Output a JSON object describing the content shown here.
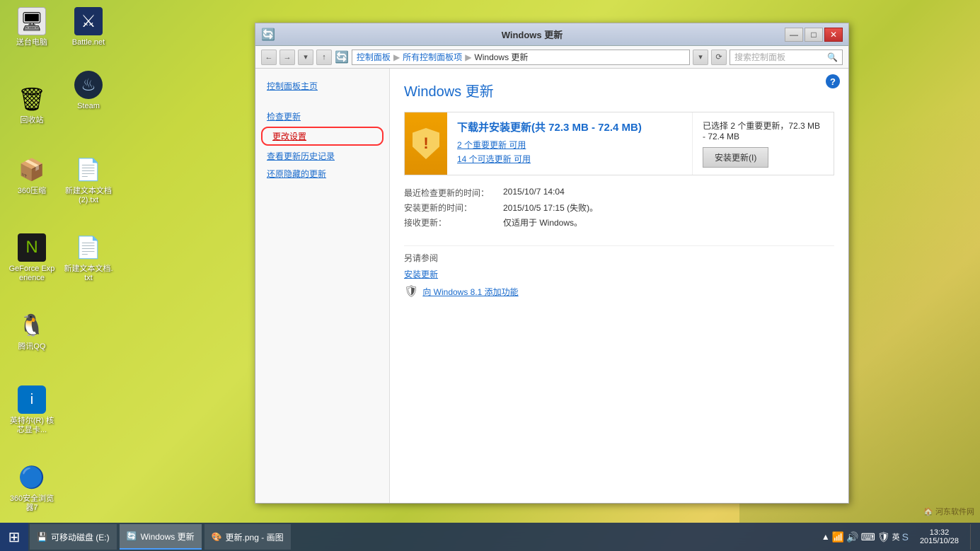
{
  "desktop": {
    "icons": [
      {
        "id": "my-computer",
        "label": "送台电脑",
        "symbol": "🖥"
      },
      {
        "id": "battle-net",
        "label": "Battle.net",
        "symbol": "🎮"
      },
      {
        "id": "recycle-bin",
        "label": "回收站",
        "symbol": "🗑"
      },
      {
        "id": "steam",
        "label": "Steam",
        "symbol": "💨"
      },
      {
        "id": "360zip",
        "label": "360压缩",
        "symbol": "📦"
      },
      {
        "id": "new-txt1",
        "label": "新建文本文档 (2).txt",
        "symbol": "📄"
      },
      {
        "id": "geforce",
        "label": "GeForce Experience",
        "symbol": "🎯"
      },
      {
        "id": "new-txt2",
        "label": "新建文本文档.txt",
        "symbol": "📄"
      },
      {
        "id": "qq",
        "label": "腾讯QQ",
        "symbol": "🐧"
      },
      {
        "id": "intel",
        "label": "英特尔(R) 核芯显卡...",
        "symbol": "💻"
      },
      {
        "id": "360browser",
        "label": "360安全浏览器7",
        "symbol": "🔵"
      }
    ]
  },
  "window": {
    "title": "Windows 更新",
    "title_bar_icon": "🔄",
    "controls": {
      "minimize": "—",
      "maximize": "□",
      "close": "✕"
    }
  },
  "address_bar": {
    "back_btn": "←",
    "forward_btn": "→",
    "up_btn": "↑",
    "refresh_btn": "⟳",
    "path": {
      "root": "控制面板",
      "sep1": "▶",
      "mid": "所有控制面板项",
      "sep2": "▶",
      "current": "Windows 更新"
    },
    "search_placeholder": "搜索控制面板",
    "dropdown_icon": "▾"
  },
  "sidebar": {
    "main_link": "控制面板主页",
    "links": [
      {
        "id": "check-update",
        "label": "检查更新",
        "highlighted": false
      },
      {
        "id": "change-settings",
        "label": "更改设置",
        "highlighted": true
      },
      {
        "id": "view-history",
        "label": "查看更新历史记录",
        "highlighted": false
      },
      {
        "id": "restore-hidden",
        "label": "还原隐藏的更新",
        "highlighted": false
      }
    ]
  },
  "main": {
    "page_title": "Windows 更新",
    "update": {
      "title": "下载并安装更新(共 72.3 MB - 72.4 MB)",
      "important_link": "2 个重要更新 可用",
      "optional_link": "14 个可选更新 可用",
      "side_text": "已选择 2 个重要更新，72.3 MB - 72.4 MB",
      "install_btn": "安装更新(I)"
    },
    "info": {
      "last_check_label": "最近检查更新的时间：",
      "last_check_value": "2015/10/7 14:04",
      "last_install_label": "安装更新的时间：",
      "last_install_value": "2015/10/5 17:15 (失败)。",
      "receive_label": "接收更新：",
      "receive_value": "仅适用于 Windows。"
    },
    "also_see": {
      "title": "另请参阅",
      "links": [
        {
          "id": "install-update",
          "label": "安装更新"
        },
        {
          "id": "add-feature",
          "label": "向 Windows 8.1 添加功能"
        }
      ]
    }
  },
  "taskbar": {
    "start_icon": "⊞",
    "items": [
      {
        "id": "removable-disk",
        "label": "可移动磁盘 (E:)",
        "icon": "💾"
      },
      {
        "id": "windows-update",
        "label": "Windows 更新",
        "icon": "🔄",
        "active": true
      },
      {
        "id": "paint",
        "label": "更新.png - 画图",
        "icon": "🎨"
      }
    ],
    "systray": {
      "icons": [
        "▲",
        "📶",
        "🔊",
        "⌨",
        "🔲",
        "🛡"
      ],
      "time": "13:32",
      "date": "2015/10/28"
    }
  },
  "watermark": "河东软件网"
}
